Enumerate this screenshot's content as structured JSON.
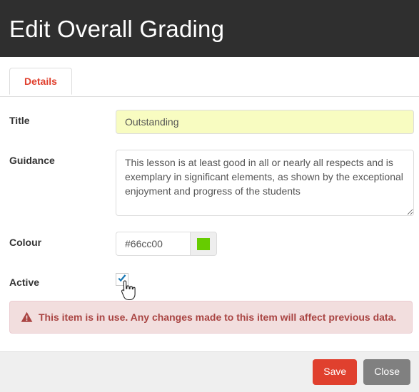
{
  "header": {
    "title": "Edit Overall Grading"
  },
  "tabs": [
    {
      "label": "Details",
      "active": true
    }
  ],
  "form": {
    "title_field": {
      "label": "Title",
      "value": "Outstanding",
      "placeholder": ""
    },
    "guidance_field": {
      "label": "Guidance",
      "value": "This lesson is at least good in all or nearly all respects and is exemplary in significant elements, as shown by the exceptional enjoyment and progress of the students",
      "placeholder": ""
    },
    "colour_field": {
      "label": "Colour",
      "value": "#66cc00",
      "placeholder": "",
      "swatch_color": "#66cc00"
    },
    "active_field": {
      "label": "Active",
      "checked": true
    }
  },
  "alert": {
    "icon": "warning-triangle-icon",
    "message": "This item is in use. Any changes made to this item will affect previous data."
  },
  "footer": {
    "save_label": "Save",
    "close_label": "Close"
  },
  "colors": {
    "header_bg": "#2f2f2f",
    "accent_red": "#e0402e",
    "alert_bg": "#f2dede",
    "alert_text": "#a94442",
    "autofill_yellow": "#f8fcc1",
    "footer_bg": "#efefef",
    "close_grey": "#808080"
  },
  "cursor": {
    "icon": "hand-pointer-cursor"
  }
}
